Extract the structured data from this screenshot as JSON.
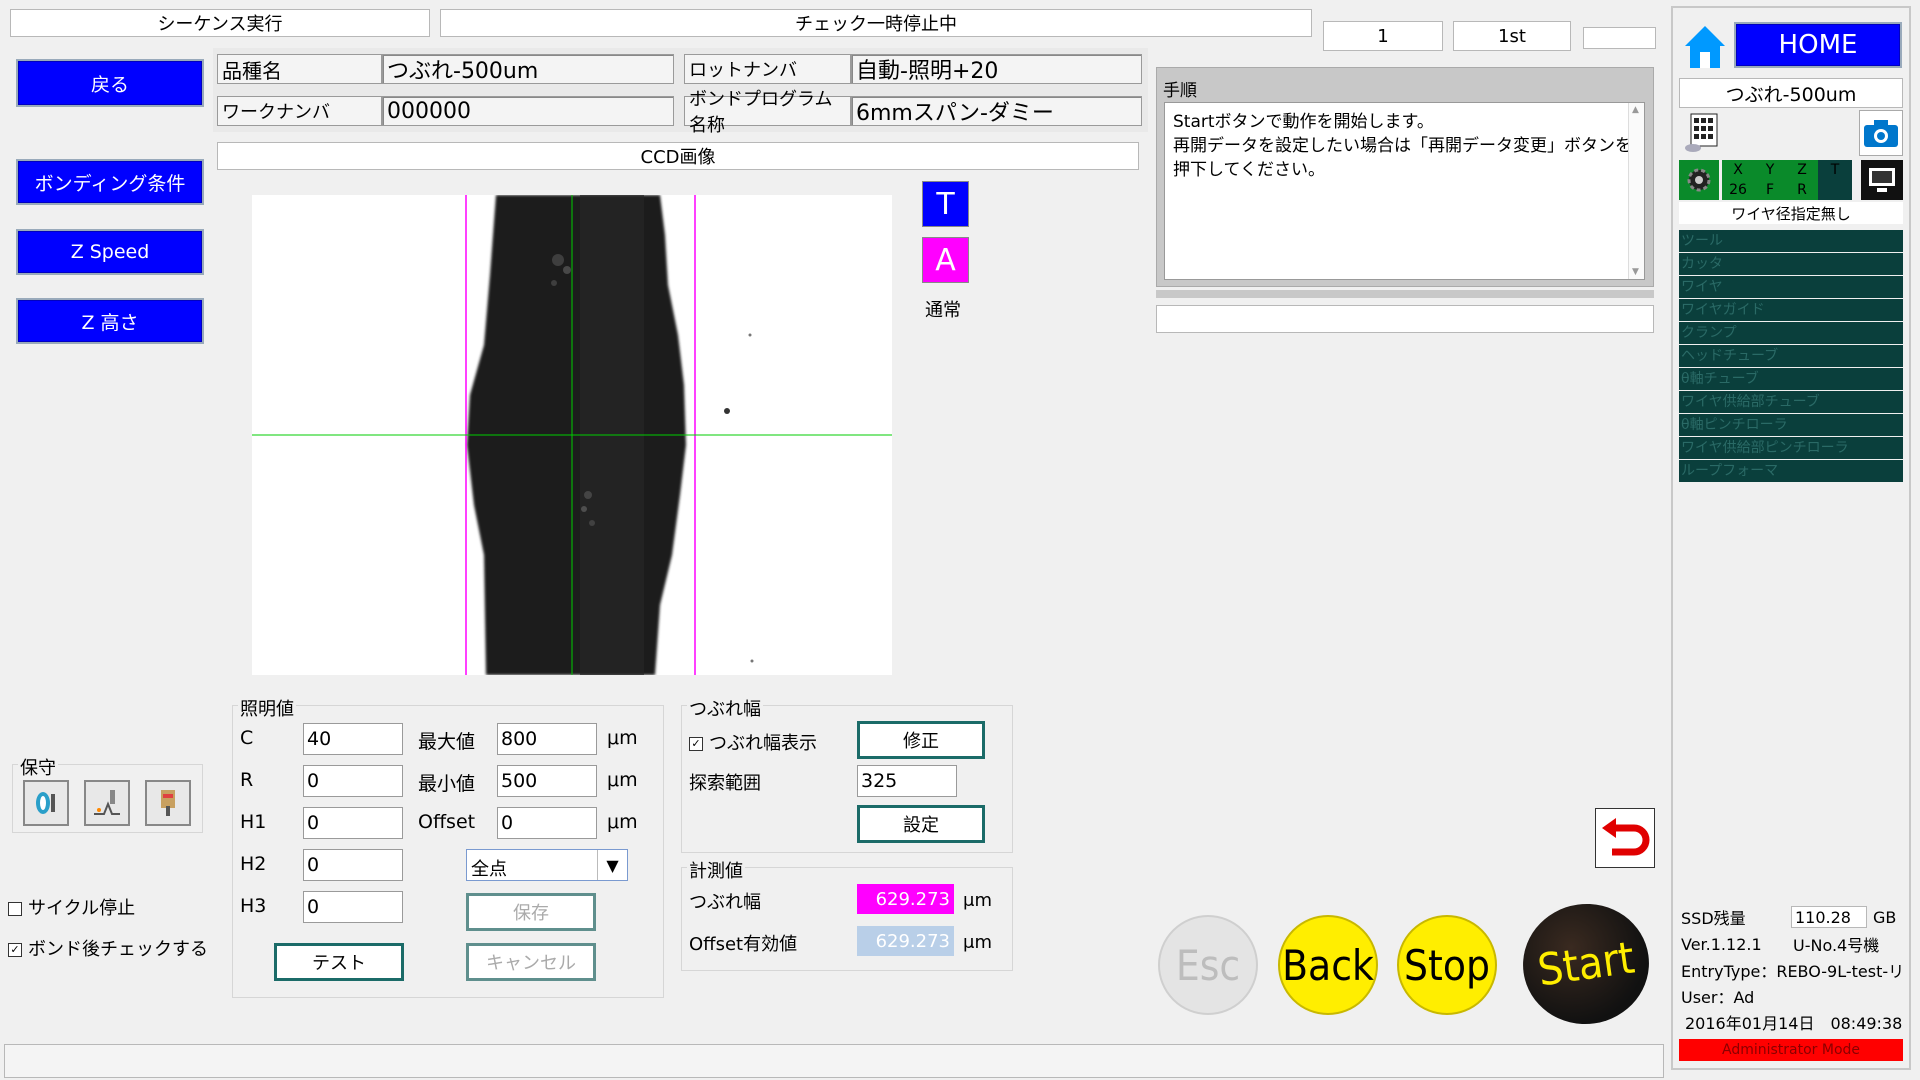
{
  "header": {
    "sequence_title": "シーケンス実行",
    "status_title": "チェック一時停止中",
    "counter": "1",
    "order": "1st",
    "extra": ""
  },
  "left_buttons": {
    "back": "戻る",
    "bonding": "ボンディング条件",
    "zspeed": "Z Speed",
    "zheight": "Z 高さ"
  },
  "info": {
    "product_label": "品種名",
    "product_value": "つぶれ-500um",
    "lot_label": "ロットナンバ",
    "lot_value": "自動-照明+20",
    "work_label": "ワークナンバ",
    "work_value": "000000",
    "program_label": "ボンドプログラム名称",
    "program_value": "6mmスパン-ダミー"
  },
  "ccd": {
    "title": "CCD画像",
    "t_label": "T",
    "a_label": "A",
    "mode": "通常"
  },
  "procedure": {
    "title": "手順",
    "lines": [
      "Startボタンで動作を開始します。",
      "再開データを設定したい場合は「再開データ変更」ボタンを",
      "押下してください。"
    ],
    "bottom_field": ""
  },
  "lighting": {
    "title": "照明値",
    "c_label": "C",
    "c_value": "40",
    "r_label": "R",
    "r_value": "0",
    "h1_label": "H1",
    "h1_value": "0",
    "h2_label": "H2",
    "h2_value": "0",
    "h3_label": "H3",
    "h3_value": "0",
    "max_label": "最大値",
    "max_value": "800",
    "min_label": "最小値",
    "min_value": "500",
    "offset_label": "Offset",
    "offset_value": "0",
    "unit": "μm",
    "select_value": "全点",
    "save": "保存",
    "test": "テスト",
    "cancel": "キャンセル"
  },
  "crush_width": {
    "title": "つぶれ幅",
    "show_label": "つぶれ幅表示",
    "fix": "修正",
    "search_label": "探索範囲",
    "search_value": "325",
    "set": "設定"
  },
  "measure": {
    "title": "計測値",
    "crush_label": "つぶれ幅",
    "crush_value": "629.273",
    "offset_label": "Offset有効値",
    "offset_value": "629.273",
    "unit": "μm"
  },
  "maintenance": {
    "title": "保守"
  },
  "options": {
    "cycle_stop": "サイクル停止",
    "check_after_bond": "ボンド後チェックする"
  },
  "action_buttons": {
    "esc": "Esc",
    "back": "Back",
    "stop": "Stop",
    "start": "Start"
  },
  "right_panel": {
    "home": "HOME",
    "product": "つぶれ-500um",
    "axis_top": [
      "X",
      "Y",
      "Z",
      "T"
    ],
    "axis_bottom": [
      "26",
      "F",
      "R",
      ""
    ],
    "wire_note": "ワイヤ径指定無し",
    "tools": [
      "ツール",
      "カッタ",
      "ワイヤ",
      "ワイヤガイド",
      "クランプ",
      "ヘッドチューブ",
      "θ軸チューブ",
      "ワイヤ供給部チューブ",
      "θ軸ピンチローラ",
      "ワイヤ供給部ピンチローラ",
      "ループフォーマ"
    ],
    "ssd_label": "SSD残量",
    "ssd_value": "110.28",
    "ssd_unit": "GB",
    "version": "Ver.1.12.1",
    "machine": "U-No.4号機",
    "entry_type": "EntryType：REBO-9L-test-リ",
    "user": "User：Ad",
    "datetime": "2016年01月14日　08:49:38",
    "mode": "Administrator Mode"
  },
  "colors": {
    "blue": "#0000ff",
    "magenta": "#ff00ff",
    "teal": "#1b6b68",
    "yellow": "#ffee00",
    "red_mode": "#ff0000"
  }
}
